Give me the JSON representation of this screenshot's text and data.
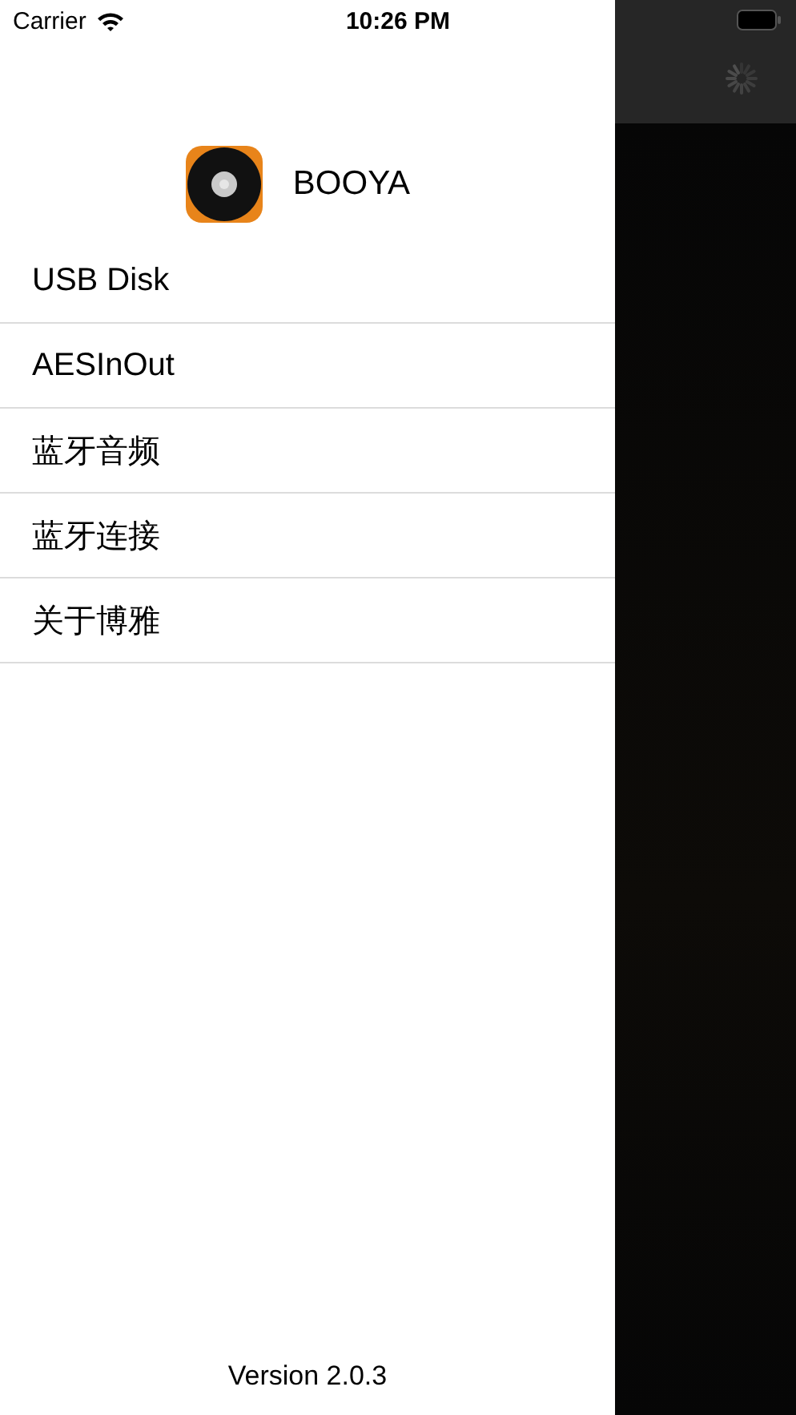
{
  "status_bar": {
    "carrier": "Carrier",
    "time": "10:26 PM"
  },
  "header": {
    "title": "BOOYA"
  },
  "menu": [
    {
      "label": "USB Disk"
    },
    {
      "label": "AESInOut"
    },
    {
      "label": "蓝牙音频"
    },
    {
      "label": "蓝牙连接"
    },
    {
      "label": "关于博雅"
    }
  ],
  "footer": {
    "version": "Version 2.0.3"
  }
}
